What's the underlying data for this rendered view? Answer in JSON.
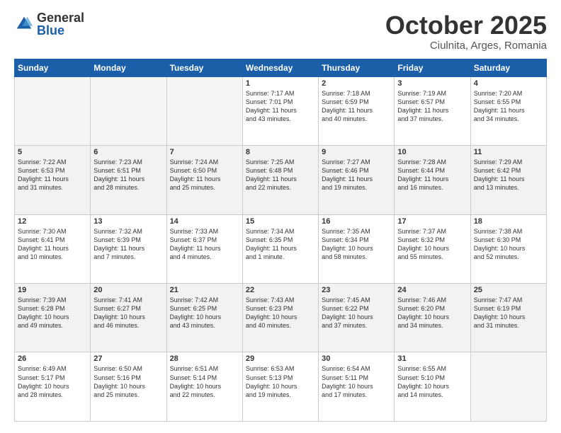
{
  "logo": {
    "general": "General",
    "blue": "Blue"
  },
  "title": "October 2025",
  "subtitle": "Ciulnita, Arges, Romania",
  "days_header": [
    "Sunday",
    "Monday",
    "Tuesday",
    "Wednesday",
    "Thursday",
    "Friday",
    "Saturday"
  ],
  "weeks": [
    [
      {
        "day": "",
        "info": ""
      },
      {
        "day": "",
        "info": ""
      },
      {
        "day": "",
        "info": ""
      },
      {
        "day": "1",
        "info": "Sunrise: 7:17 AM\nSunset: 7:01 PM\nDaylight: 11 hours\nand 43 minutes."
      },
      {
        "day": "2",
        "info": "Sunrise: 7:18 AM\nSunset: 6:59 PM\nDaylight: 11 hours\nand 40 minutes."
      },
      {
        "day": "3",
        "info": "Sunrise: 7:19 AM\nSunset: 6:57 PM\nDaylight: 11 hours\nand 37 minutes."
      },
      {
        "day": "4",
        "info": "Sunrise: 7:20 AM\nSunset: 6:55 PM\nDaylight: 11 hours\nand 34 minutes."
      }
    ],
    [
      {
        "day": "5",
        "info": "Sunrise: 7:22 AM\nSunset: 6:53 PM\nDaylight: 11 hours\nand 31 minutes."
      },
      {
        "day": "6",
        "info": "Sunrise: 7:23 AM\nSunset: 6:51 PM\nDaylight: 11 hours\nand 28 minutes."
      },
      {
        "day": "7",
        "info": "Sunrise: 7:24 AM\nSunset: 6:50 PM\nDaylight: 11 hours\nand 25 minutes."
      },
      {
        "day": "8",
        "info": "Sunrise: 7:25 AM\nSunset: 6:48 PM\nDaylight: 11 hours\nand 22 minutes."
      },
      {
        "day": "9",
        "info": "Sunrise: 7:27 AM\nSunset: 6:46 PM\nDaylight: 11 hours\nand 19 minutes."
      },
      {
        "day": "10",
        "info": "Sunrise: 7:28 AM\nSunset: 6:44 PM\nDaylight: 11 hours\nand 16 minutes."
      },
      {
        "day": "11",
        "info": "Sunrise: 7:29 AM\nSunset: 6:42 PM\nDaylight: 11 hours\nand 13 minutes."
      }
    ],
    [
      {
        "day": "12",
        "info": "Sunrise: 7:30 AM\nSunset: 6:41 PM\nDaylight: 11 hours\nand 10 minutes."
      },
      {
        "day": "13",
        "info": "Sunrise: 7:32 AM\nSunset: 6:39 PM\nDaylight: 11 hours\nand 7 minutes."
      },
      {
        "day": "14",
        "info": "Sunrise: 7:33 AM\nSunset: 6:37 PM\nDaylight: 11 hours\nand 4 minutes."
      },
      {
        "day": "15",
        "info": "Sunrise: 7:34 AM\nSunset: 6:35 PM\nDaylight: 11 hours\nand 1 minute."
      },
      {
        "day": "16",
        "info": "Sunrise: 7:35 AM\nSunset: 6:34 PM\nDaylight: 10 hours\nand 58 minutes."
      },
      {
        "day": "17",
        "info": "Sunrise: 7:37 AM\nSunset: 6:32 PM\nDaylight: 10 hours\nand 55 minutes."
      },
      {
        "day": "18",
        "info": "Sunrise: 7:38 AM\nSunset: 6:30 PM\nDaylight: 10 hours\nand 52 minutes."
      }
    ],
    [
      {
        "day": "19",
        "info": "Sunrise: 7:39 AM\nSunset: 6:28 PM\nDaylight: 10 hours\nand 49 minutes."
      },
      {
        "day": "20",
        "info": "Sunrise: 7:41 AM\nSunset: 6:27 PM\nDaylight: 10 hours\nand 46 minutes."
      },
      {
        "day": "21",
        "info": "Sunrise: 7:42 AM\nSunset: 6:25 PM\nDaylight: 10 hours\nand 43 minutes."
      },
      {
        "day": "22",
        "info": "Sunrise: 7:43 AM\nSunset: 6:23 PM\nDaylight: 10 hours\nand 40 minutes."
      },
      {
        "day": "23",
        "info": "Sunrise: 7:45 AM\nSunset: 6:22 PM\nDaylight: 10 hours\nand 37 minutes."
      },
      {
        "day": "24",
        "info": "Sunrise: 7:46 AM\nSunset: 6:20 PM\nDaylight: 10 hours\nand 34 minutes."
      },
      {
        "day": "25",
        "info": "Sunrise: 7:47 AM\nSunset: 6:19 PM\nDaylight: 10 hours\nand 31 minutes."
      }
    ],
    [
      {
        "day": "26",
        "info": "Sunrise: 6:49 AM\nSunset: 5:17 PM\nDaylight: 10 hours\nand 28 minutes."
      },
      {
        "day": "27",
        "info": "Sunrise: 6:50 AM\nSunset: 5:16 PM\nDaylight: 10 hours\nand 25 minutes."
      },
      {
        "day": "28",
        "info": "Sunrise: 6:51 AM\nSunset: 5:14 PM\nDaylight: 10 hours\nand 22 minutes."
      },
      {
        "day": "29",
        "info": "Sunrise: 6:53 AM\nSunset: 5:13 PM\nDaylight: 10 hours\nand 19 minutes."
      },
      {
        "day": "30",
        "info": "Sunrise: 6:54 AM\nSunset: 5:11 PM\nDaylight: 10 hours\nand 17 minutes."
      },
      {
        "day": "31",
        "info": "Sunrise: 6:55 AM\nSunset: 5:10 PM\nDaylight: 10 hours\nand 14 minutes."
      },
      {
        "day": "",
        "info": ""
      }
    ]
  ]
}
